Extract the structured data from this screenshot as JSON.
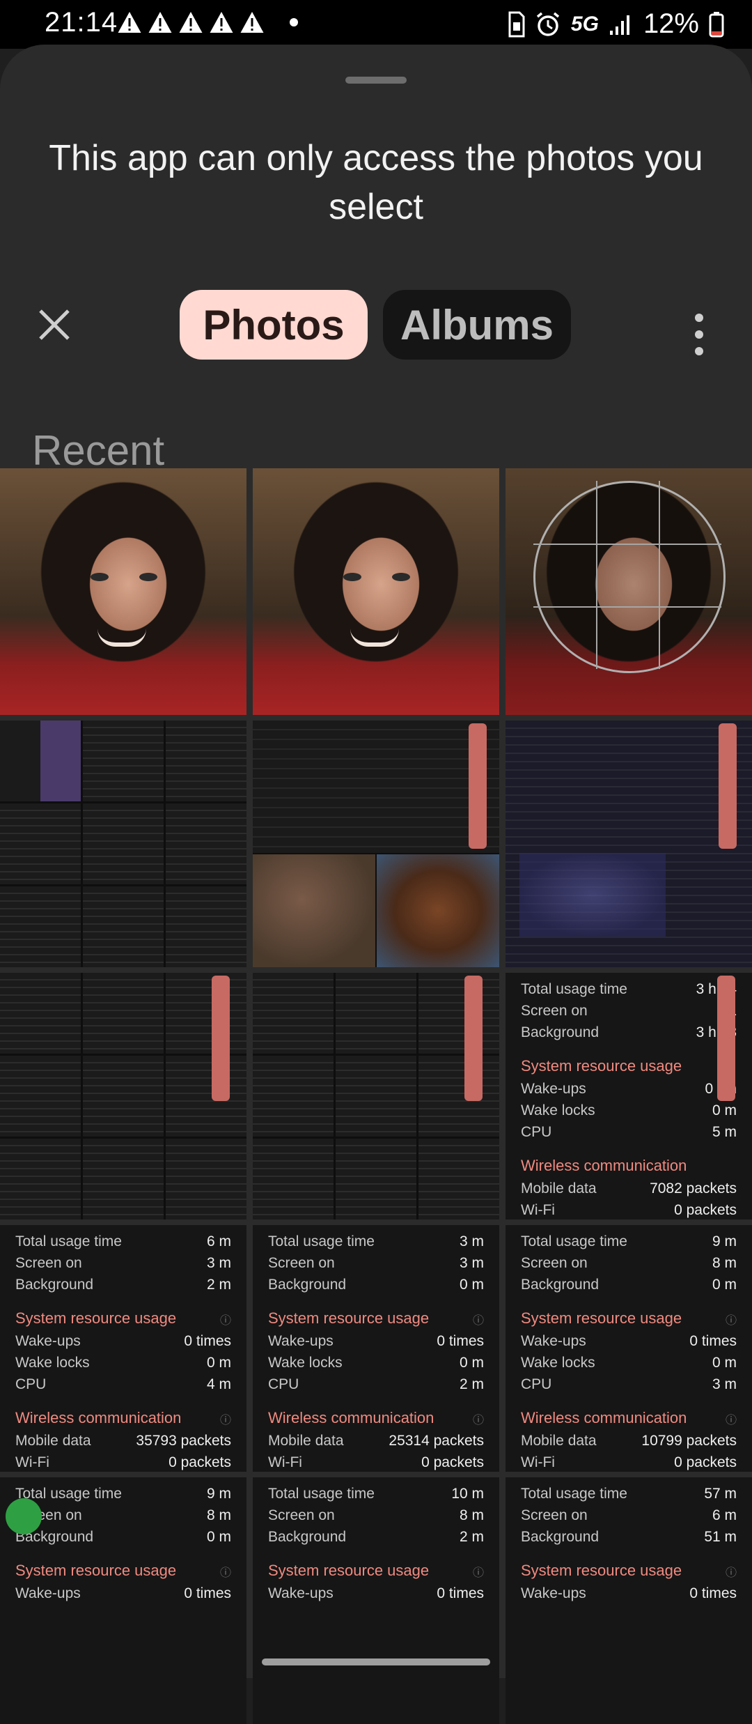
{
  "status_bar": {
    "time": "21:14",
    "network": "5G",
    "battery": "12%"
  },
  "picker": {
    "title": "This app can only access the photos you select",
    "tabs": [
      {
        "label": "Photos",
        "selected": true
      },
      {
        "label": "Albums",
        "selected": false
      }
    ],
    "section_title": "Recent"
  },
  "stats_cards": [
    {
      "total_label": "Total usage time",
      "total": "3 h 44",
      "screen_label": "Screen on",
      "screen": "1",
      "bg_label": "Background",
      "bg": "3 h 43",
      "sys_title": "System resource usage",
      "wakeups_label": "Wake-ups",
      "wakeups": "0 tim",
      "locks_label": "Wake locks",
      "locks": "0 m",
      "cpu_label": "CPU",
      "cpu": "5 m",
      "wireless_title": "Wireless communication",
      "mobile_label": "Mobile data",
      "mobile": "7082 packets",
      "wifi_label": "Wi-Fi",
      "wifi": "0 packets"
    },
    {
      "total_label": "Total usage time",
      "total": "6 m",
      "screen_label": "Screen on",
      "screen": "3 m",
      "bg_label": "Background",
      "bg": "2 m",
      "sys_title": "System resource usage",
      "wakeups_label": "Wake-ups",
      "wakeups": "0 times",
      "locks_label": "Wake locks",
      "locks": "0 m",
      "cpu_label": "CPU",
      "cpu": "4 m",
      "wireless_title": "Wireless communication",
      "mobile_label": "Mobile data",
      "mobile": "35793 packets",
      "wifi_label": "Wi-Fi",
      "wifi": "0 packets"
    },
    {
      "total_label": "Total usage time",
      "total": "3 m",
      "screen_label": "Screen on",
      "screen": "3 m",
      "bg_label": "Background",
      "bg": "0 m",
      "sys_title": "System resource usage",
      "wakeups_label": "Wake-ups",
      "wakeups": "0 times",
      "locks_label": "Wake locks",
      "locks": "0 m",
      "cpu_label": "CPU",
      "cpu": "2 m",
      "wireless_title": "Wireless communication",
      "mobile_label": "Mobile data",
      "mobile": "25314 packets",
      "wifi_label": "Wi-Fi",
      "wifi": "0 packets"
    },
    {
      "total_label": "Total usage time",
      "total": "9 m",
      "screen_label": "Screen on",
      "screen": "8 m",
      "bg_label": "Background",
      "bg": "0 m",
      "sys_title": "System resource usage",
      "wakeups_label": "Wake-ups",
      "wakeups": "0 times",
      "locks_label": "Wake locks",
      "locks": "0 m",
      "cpu_label": "CPU",
      "cpu": "3 m",
      "wireless_title": "Wireless communication",
      "mobile_label": "Mobile data",
      "mobile": "10799 packets",
      "wifi_label": "Wi-Fi",
      "wifi": "0 packets"
    },
    {
      "total_label": "Total usage time",
      "total": "9 m",
      "screen_label": "Screen on",
      "screen": "8 m",
      "bg_label": "Background",
      "bg": "0 m",
      "sys_title": "System resource usage",
      "wakeups_label": "Wake-ups",
      "wakeups": "0 times"
    },
    {
      "total_label": "Total usage time",
      "total": "10 m",
      "screen_label": "Screen on",
      "screen": "8 m",
      "bg_label": "Background",
      "bg": "2 m",
      "sys_title": "System resource usage",
      "wakeups_label": "Wake-ups",
      "wakeups": "0 times"
    },
    {
      "total_label": "Total usage time",
      "total": "57 m",
      "screen_label": "Screen on",
      "screen": "6 m",
      "bg_label": "Background",
      "bg": "51 m",
      "sys_title": "System resource usage",
      "wakeups_label": "Wake-ups",
      "wakeups": "0 times"
    }
  ]
}
